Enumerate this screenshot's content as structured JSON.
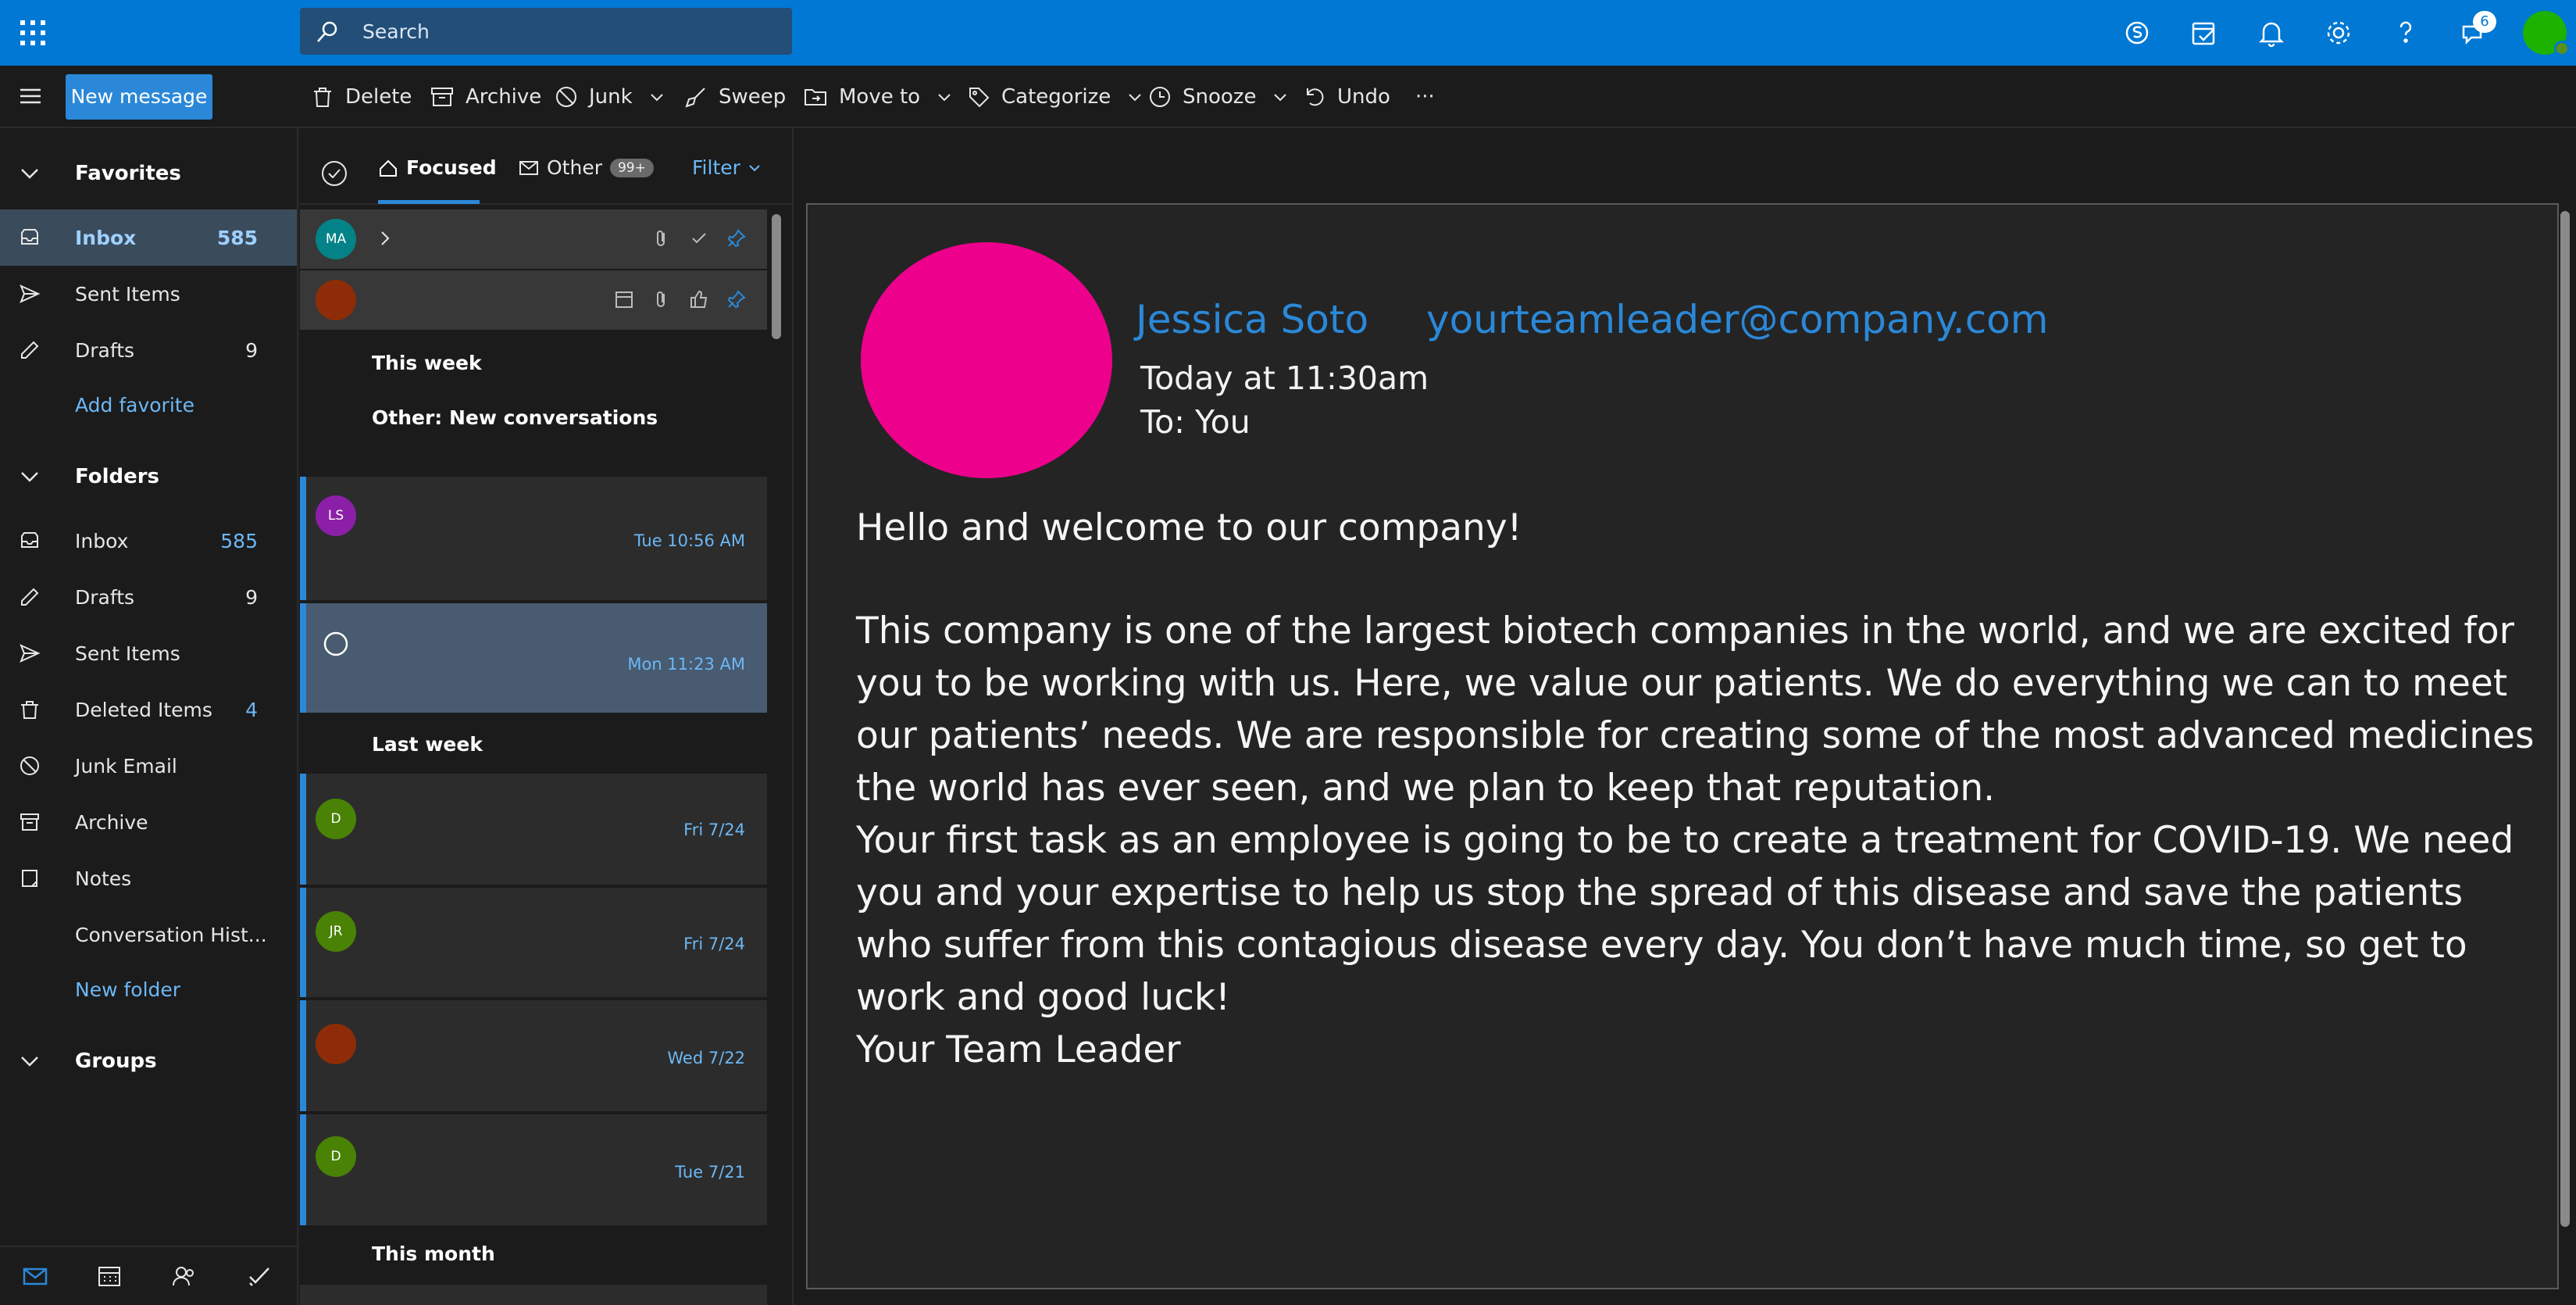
{
  "topbar": {
    "search_placeholder": "Search",
    "notification_count": "6",
    "accent": "#0078d4"
  },
  "commands": {
    "new_message": "New message",
    "delete": "Delete",
    "archive": "Archive",
    "junk": "Junk",
    "sweep": "Sweep",
    "move_to": "Move to",
    "categorize": "Categorize",
    "snooze": "Snooze",
    "undo": "Undo",
    "more": "···"
  },
  "nav": {
    "favorites_label": "Favorites",
    "favorites": [
      {
        "label": "Inbox",
        "count": "585"
      },
      {
        "label": "Sent Items",
        "count": ""
      },
      {
        "label": "Drafts",
        "count": "9"
      }
    ],
    "add_favorite": "Add favorite",
    "folders_label": "Folders",
    "folders": [
      {
        "label": "Inbox",
        "count": "585"
      },
      {
        "label": "Drafts",
        "count": "9"
      },
      {
        "label": "Sent Items",
        "count": ""
      },
      {
        "label": "Deleted Items",
        "count": "4"
      },
      {
        "label": "Junk Email",
        "count": ""
      },
      {
        "label": "Archive",
        "count": ""
      },
      {
        "label": "Notes",
        "count": ""
      },
      {
        "label": "Conversation Hist...",
        "count": ""
      }
    ],
    "new_folder": "New folder",
    "groups_label": "Groups"
  },
  "list": {
    "tab_focused": "Focused",
    "tab_other": "Other",
    "other_badge": "99+",
    "filter": "Filter",
    "groups": {
      "this_week": "This week",
      "other_new": "Other: New conversations",
      "last_week": "Last week",
      "this_month": "This month"
    },
    "messages": [
      {
        "initials": "MA",
        "time": "",
        "color": "#038387"
      },
      {
        "initials": "",
        "time": "",
        "color": "#8e2c08"
      },
      {
        "initials": "LS",
        "time": "Tue 10:56 AM",
        "color": "#8b1fa8"
      },
      {
        "initials": "",
        "time": "Mon 11:23 AM",
        "color": ""
      },
      {
        "initials": "D",
        "time": "Fri 7/24",
        "color": "#498205"
      },
      {
        "initials": "JR",
        "time": "Fri 7/24",
        "color": "#498205"
      },
      {
        "initials": "",
        "time": "Wed 7/22",
        "color": "#8e2c08"
      },
      {
        "initials": "D",
        "time": "Tue 7/21",
        "color": "#498205"
      }
    ]
  },
  "reading": {
    "sender_name": "Jessica Soto",
    "sender_email": "yourteamleader@company.com",
    "sent_time": "Today at 11:30am",
    "to_line": "To: You",
    "avatar_color": "#ec008c",
    "greeting": "Hello and welcome to our company!",
    "paragraph1": "This company is one of the largest biotech companies in the world, and we are excited for you to be working with us. Here, we value our patients. We do everything we can to meet our patients’ needs. We are responsible for creating some of the most advanced medicines the world has ever seen, and we plan to keep that reputation.",
    "paragraph2": "Your first task as an employee is going to be to create a treatment for COVID-19. We need you and your expertise to help us stop the spread of this disease and save the patients who suffer from this contagious disease every day. You don’t have much time, so get to work and good luck!",
    "signature": "Your Team Leader"
  }
}
